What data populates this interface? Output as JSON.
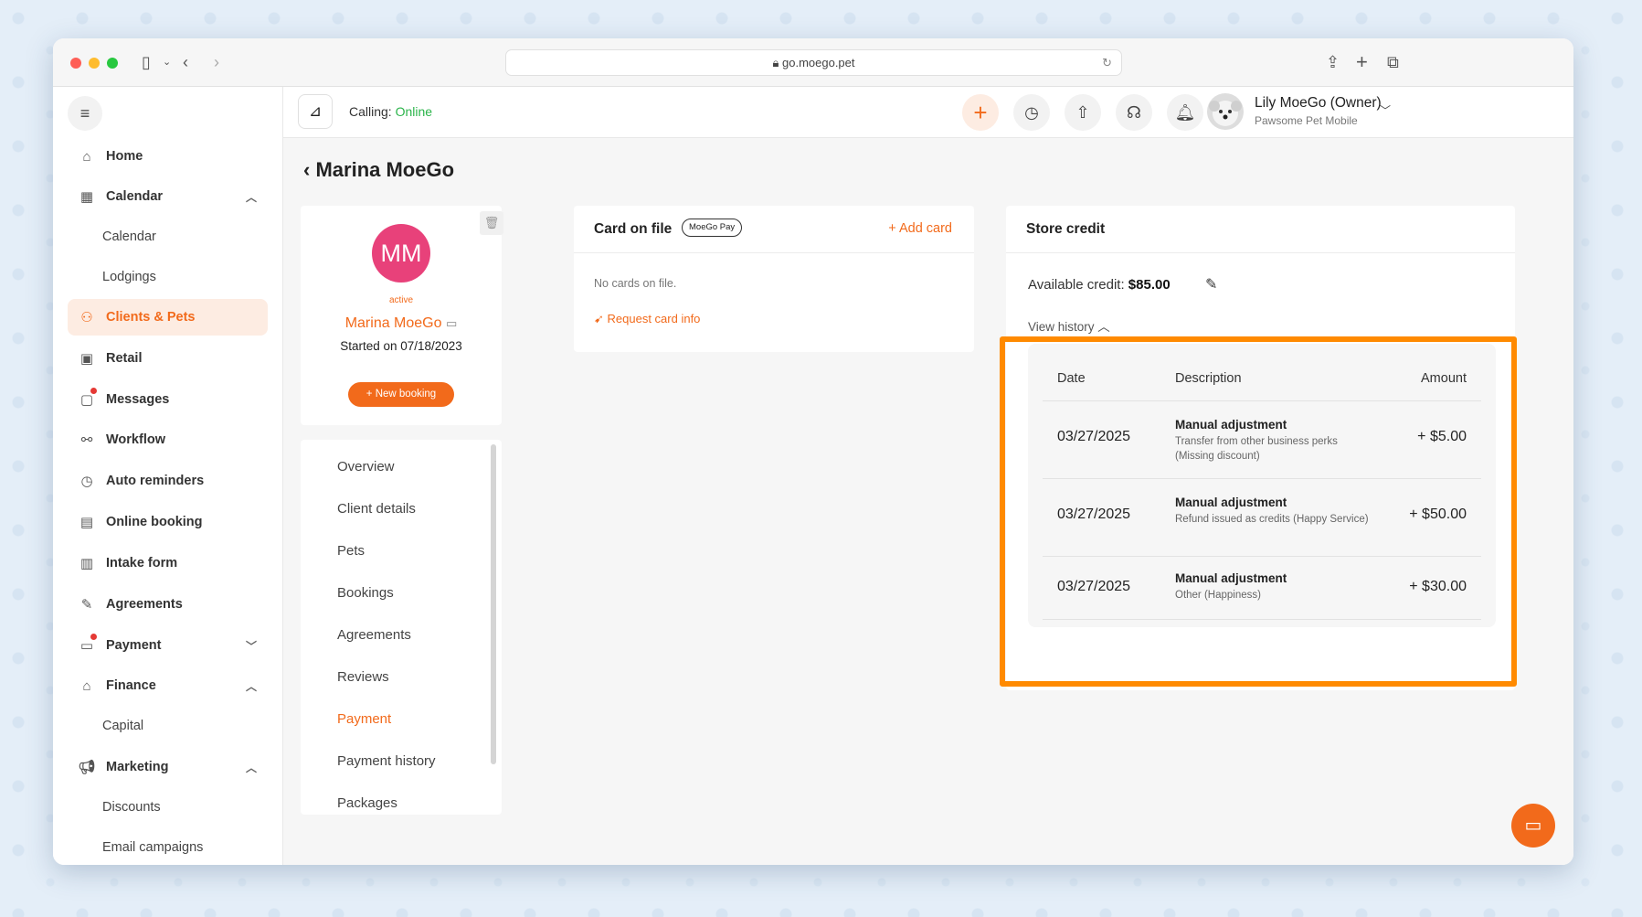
{
  "browser": {
    "url": "go.moego.pet"
  },
  "sidebar": {
    "items": [
      {
        "label": "Home",
        "icon": "home-icon"
      },
      {
        "label": "Calendar",
        "icon": "calendar-icon"
      },
      {
        "label": "Calendar",
        "icon": ""
      },
      {
        "label": "Lodgings",
        "icon": ""
      },
      {
        "label": "Clients & Pets",
        "icon": "clients-icon"
      },
      {
        "label": "Retail",
        "icon": "retail-icon"
      },
      {
        "label": "Messages",
        "icon": "messages-icon"
      },
      {
        "label": "Workflow",
        "icon": "workflow-icon"
      },
      {
        "label": "Auto reminders",
        "icon": "reminder-icon"
      },
      {
        "label": "Online booking",
        "icon": "online-booking-icon"
      },
      {
        "label": "Intake form",
        "icon": "intake-form-icon"
      },
      {
        "label": "Agreements",
        "icon": "agreements-icon"
      },
      {
        "label": "Payment",
        "icon": "payment-icon"
      },
      {
        "label": "Finance",
        "icon": "finance-icon"
      },
      {
        "label": "Capital",
        "icon": ""
      },
      {
        "label": "Discounts",
        "icon": ""
      },
      {
        "label": "Marketing",
        "icon": "marketing-icon"
      },
      {
        "label": "Email campaigns",
        "icon": ""
      }
    ]
  },
  "topbar": {
    "calling_label": "Calling:",
    "calling_status": "Online",
    "user_name": "Lily MoeGo (Owner)",
    "business": "Pawsome Pet Mobile"
  },
  "client": {
    "title": "Marina MoeGo",
    "initials": "MM",
    "status": "active",
    "name": "Marina MoeGo",
    "started": "Started on 07/18/2023",
    "new_booking": "+ New booking"
  },
  "subnav": [
    "Overview",
    "Client details",
    "Pets",
    "Bookings",
    "Agreements",
    "Reviews",
    "Payment",
    "Payment history",
    "Packages"
  ],
  "card_on_file": {
    "title": "Card on file",
    "badge": "MoeGo Pay",
    "add_card": "+ Add card",
    "empty": "No cards on file.",
    "request": "Request card info"
  },
  "store_credit": {
    "title": "Store credit",
    "available_label": "Available credit:",
    "available_value": "$85.00",
    "view_history": "View history",
    "headers": {
      "date": "Date",
      "description": "Description",
      "amount": "Amount"
    },
    "rows": [
      {
        "date": "03/27/2025",
        "title": "Manual adjustment",
        "detail": "Transfer from other business perks (Missing discount)",
        "amount": "+ $5.00"
      },
      {
        "date": "03/27/2025",
        "title": "Manual adjustment",
        "detail": "Refund issued as credits (Happy Service)",
        "amount": "+ $50.00"
      },
      {
        "date": "03/27/2025",
        "title": "Manual adjustment",
        "detail": "Other (Happiness)",
        "amount": "+ $30.00"
      }
    ]
  },
  "colors": {
    "accent": "#f26a1b",
    "online": "#2bb44a",
    "highlight": "#ff8a00",
    "avatar": "#e8417a"
  }
}
